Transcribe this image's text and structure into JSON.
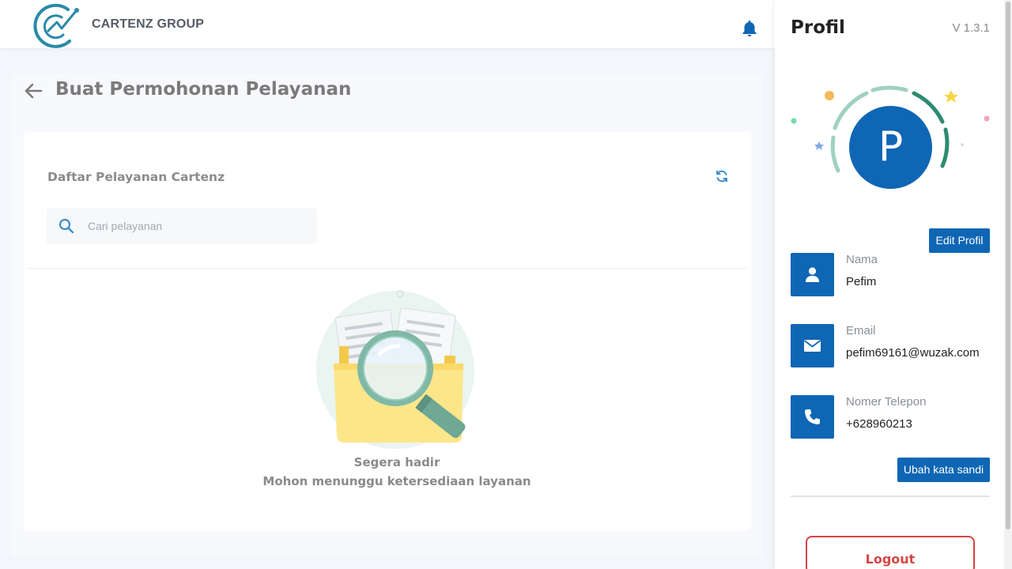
{
  "header": {
    "brand": "CARTENZ GROUP",
    "notification_icon": "bell-icon"
  },
  "page": {
    "title": "Buat Permohonan Pelayanan",
    "back_icon": "arrow-left-icon"
  },
  "services": {
    "card_title": "Daftar Pelayanan Cartenz",
    "refresh_icon": "refresh-icon",
    "search": {
      "placeholder": "Cari pelayanan",
      "value": ""
    },
    "empty_state": {
      "illustration": "folder-magnifier-illustration",
      "line1": "Segera hadir",
      "line2": "Mohon menunggu ketersediaan layanan"
    }
  },
  "profile": {
    "title": "Profil",
    "version": "V 1.3.1",
    "avatar_initial": "P",
    "edit_button": "Edit Profil",
    "fields": [
      {
        "label": "Nama",
        "value": "Pefim",
        "icon": "user-icon"
      },
      {
        "label": "Email",
        "value": "pefim69161@wuzak.com",
        "icon": "envelope-icon"
      },
      {
        "label": "Nomer Telepon",
        "value": "+628960213",
        "icon": "phone-icon"
      }
    ],
    "change_password_button": "Ubah kata sandi",
    "logout_button": "Logout"
  },
  "colors": {
    "primary": "#0f66b4",
    "logout": "#d64545",
    "brand_teal": "#2a8aa8"
  }
}
